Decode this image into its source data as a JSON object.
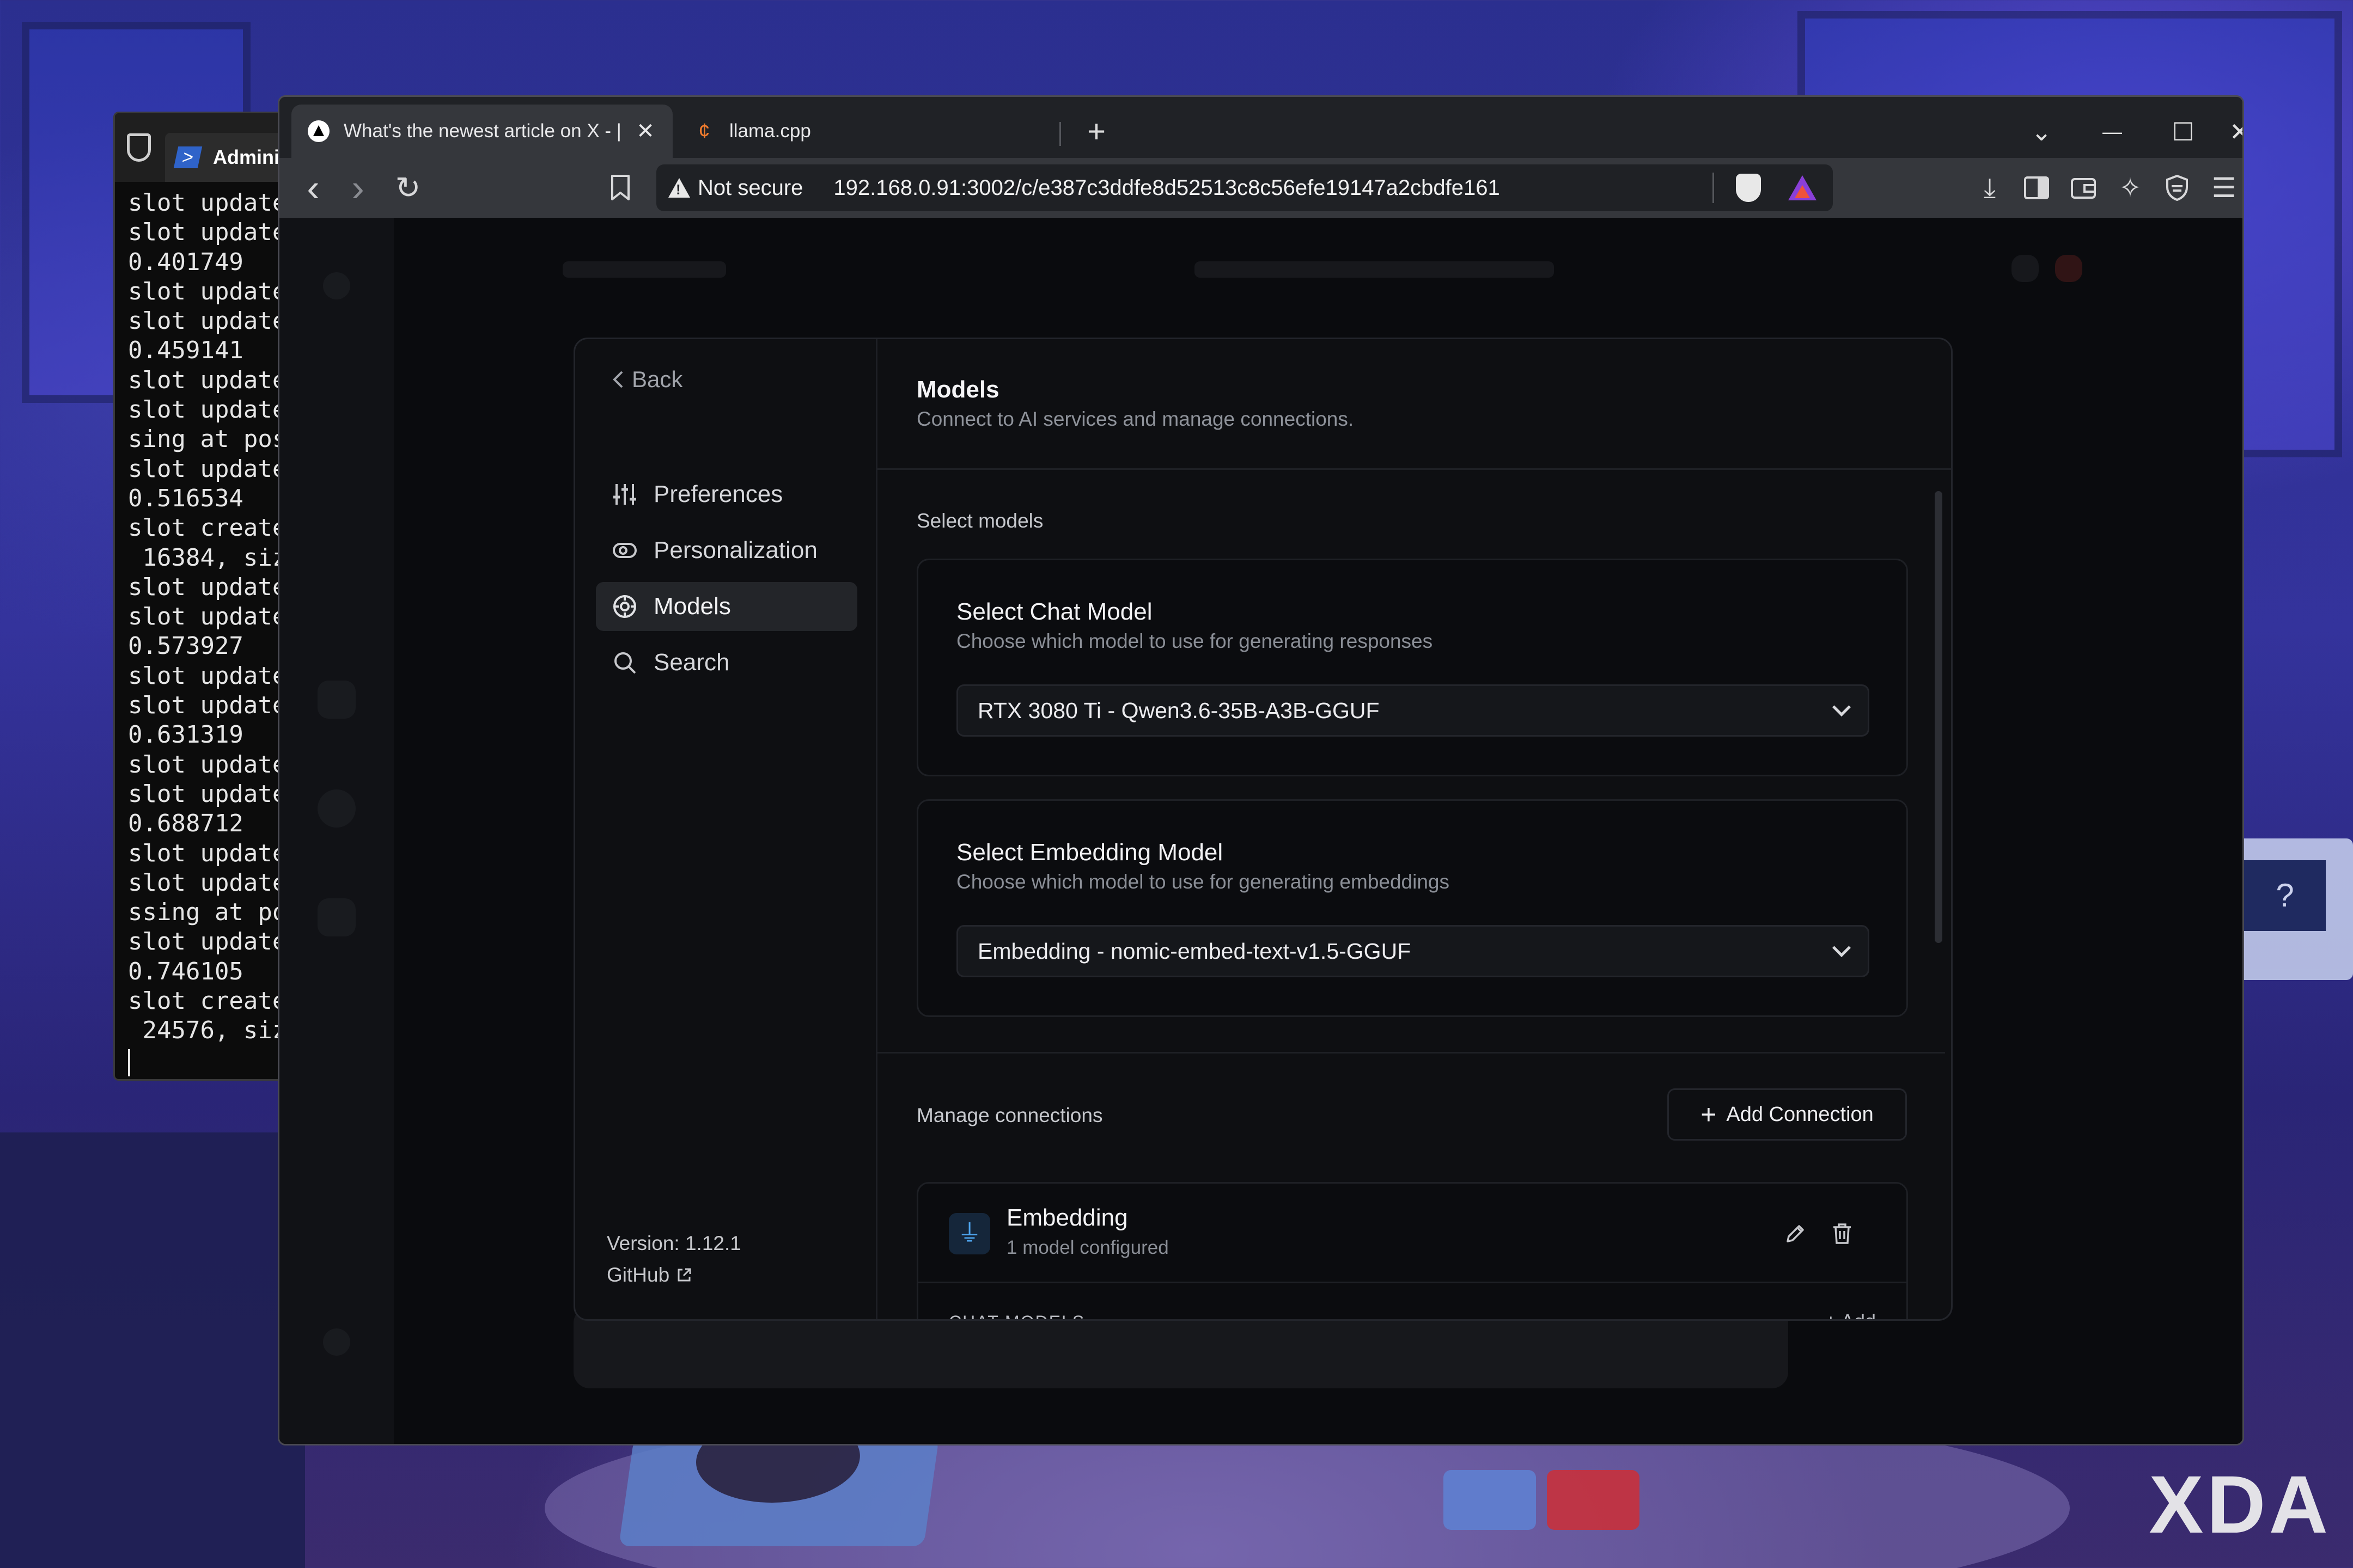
{
  "wallpaper": {
    "watermark": "XDA",
    "monitor_glyph": "?"
  },
  "terminal": {
    "tab_title": "Admini",
    "lines": [
      "slot update",
      "slot update",
      "0.401749",
      "slot update",
      "slot update",
      "0.459141",
      "slot update",
      "slot update",
      "sing at pos",
      "slot update",
      "0.516534",
      "slot create",
      " 16384, siz",
      "slot update",
      "slot update",
      "0.573927",
      "slot update",
      "slot update",
      "0.631319",
      "slot update",
      "slot update",
      "0.688712",
      "slot update",
      "slot update",
      "ssing at po",
      "slot update",
      "0.746105",
      "slot create",
      " 24576, siz"
    ]
  },
  "browser": {
    "tabs": [
      {
        "title": "What's the newest article on X - |",
        "icon": "ai-triangle-icon",
        "active": true,
        "close": "✕"
      },
      {
        "title": "llama.cpp",
        "icon": "llama-icon",
        "active": false
      }
    ],
    "new_tab": "+",
    "window_controls": {
      "list": "⌄",
      "minimize": "—",
      "maximize": "☐",
      "close": "✕"
    },
    "nav": {
      "back": "‹",
      "forward": "›",
      "reload": "↻",
      "bookmark": "⚑"
    },
    "address": {
      "security_label": "Not secure",
      "url": "192.168.0.91:3002/c/e387c3ddfe8d52513c8c56efe19147a2cbdfe161"
    },
    "toolbar_right": [
      "download-icon",
      "sidebar-icon",
      "wallet-icon",
      "leo-ai-icon",
      "vpn-shield-icon",
      "menu-icon"
    ]
  },
  "settings": {
    "nav": {
      "back_label": "Back",
      "items": [
        {
          "label": "Preferences",
          "icon": "sliders-icon",
          "selected": false
        },
        {
          "label": "Personalization",
          "icon": "toggle-icon",
          "selected": false
        },
        {
          "label": "Models",
          "icon": "models-icon",
          "selected": true
        },
        {
          "label": "Search",
          "icon": "search-icon",
          "selected": false
        }
      ],
      "version": "Version: 1.12.1",
      "github": "GitHub"
    },
    "header": {
      "title": "Models",
      "subtitle": "Connect to AI services and manage connections."
    },
    "select_models": {
      "section_label": "Select models",
      "chat": {
        "title": "Select Chat Model",
        "description": "Choose which model to use for generating responses",
        "value": "RTX 3080 Ti - Qwen3.6-35B-A3B-GGUF"
      },
      "embedding": {
        "title": "Select Embedding Model",
        "description": "Choose which model to use for generating embeddings",
        "value": "Embedding - nomic-embed-text-v1.5-GGUF"
      }
    },
    "connections": {
      "section_label": "Manage connections",
      "add_button": "Add Connection",
      "items": [
        {
          "name": "Embedding",
          "summary": "1 model configured",
          "chat_models_label": "CHAT MODELS",
          "add_label": "+ Add"
        }
      ]
    }
  }
}
